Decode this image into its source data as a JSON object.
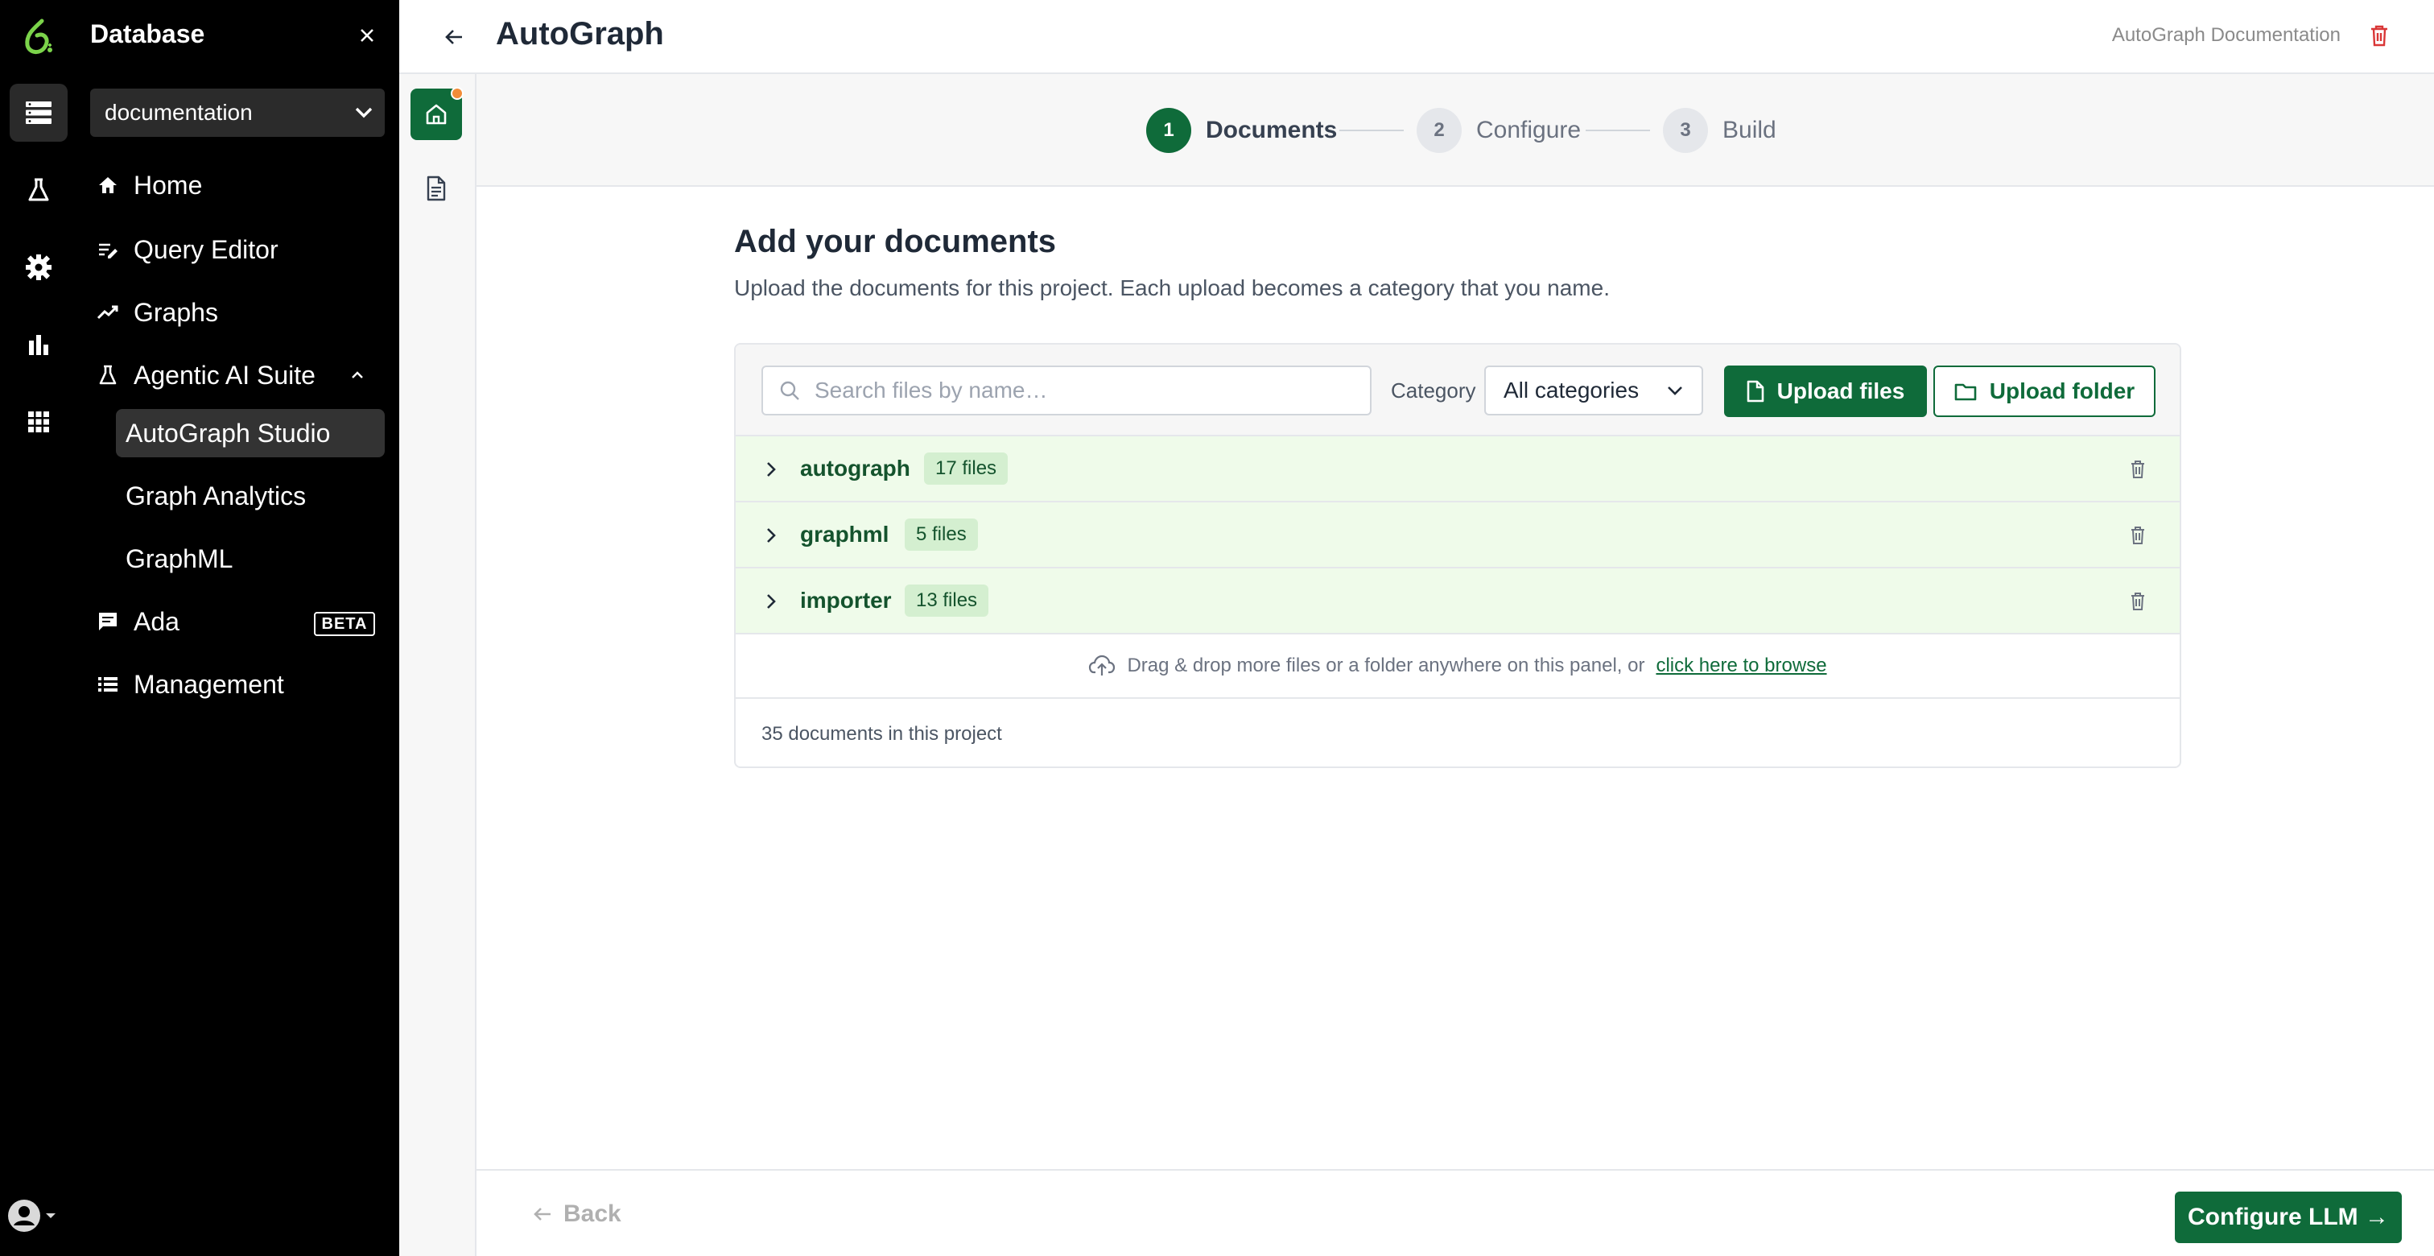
{
  "sidebar": {
    "title": "Database",
    "database_select": "documentation",
    "items": [
      {
        "label": "Home",
        "icon": "home-icon"
      },
      {
        "label": "Query Editor",
        "icon": "query-editor-icon"
      },
      {
        "label": "Graphs",
        "icon": "graphs-icon"
      },
      {
        "label": "Agentic AI Suite",
        "icon": "flask-icon"
      },
      {
        "label": "AutoGraph Studio"
      },
      {
        "label": "Graph Analytics"
      },
      {
        "label": "GraphML"
      },
      {
        "label": "Ada",
        "icon": "chat-icon",
        "badge": "BETA"
      },
      {
        "label": "Management",
        "icon": "list-icon"
      }
    ]
  },
  "header": {
    "title": "AutoGraph",
    "doc_link": "AutoGraph Documentation"
  },
  "stepper": {
    "steps": [
      {
        "num": "1",
        "label": "Documents"
      },
      {
        "num": "2",
        "label": "Configure"
      },
      {
        "num": "3",
        "label": "Build"
      }
    ]
  },
  "main": {
    "title": "Add your documents",
    "subtitle": "Upload the documents for this project. Each upload becomes a category that you name.",
    "search_placeholder": "Search files by name…",
    "category_label": "Category",
    "category_value": "All categories",
    "upload_files": "Upload files",
    "upload_folder": "Upload folder",
    "categories": [
      {
        "name": "autograph",
        "count": "17 files"
      },
      {
        "name": "graphml",
        "count": "5 files"
      },
      {
        "name": "importer",
        "count": "13 files"
      }
    ],
    "drop_text": "Drag & drop more files or a folder anywhere on this panel, or",
    "drop_link": "click here to browse",
    "doc_count": "35 documents in this project"
  },
  "footer": {
    "back": "Back",
    "next": "Configure LLM →"
  },
  "colors": {
    "brand_green": "#0f6b3a",
    "row_green": "#effbea",
    "notification_dot": "#f28c38",
    "delete_red": "#d93636"
  }
}
